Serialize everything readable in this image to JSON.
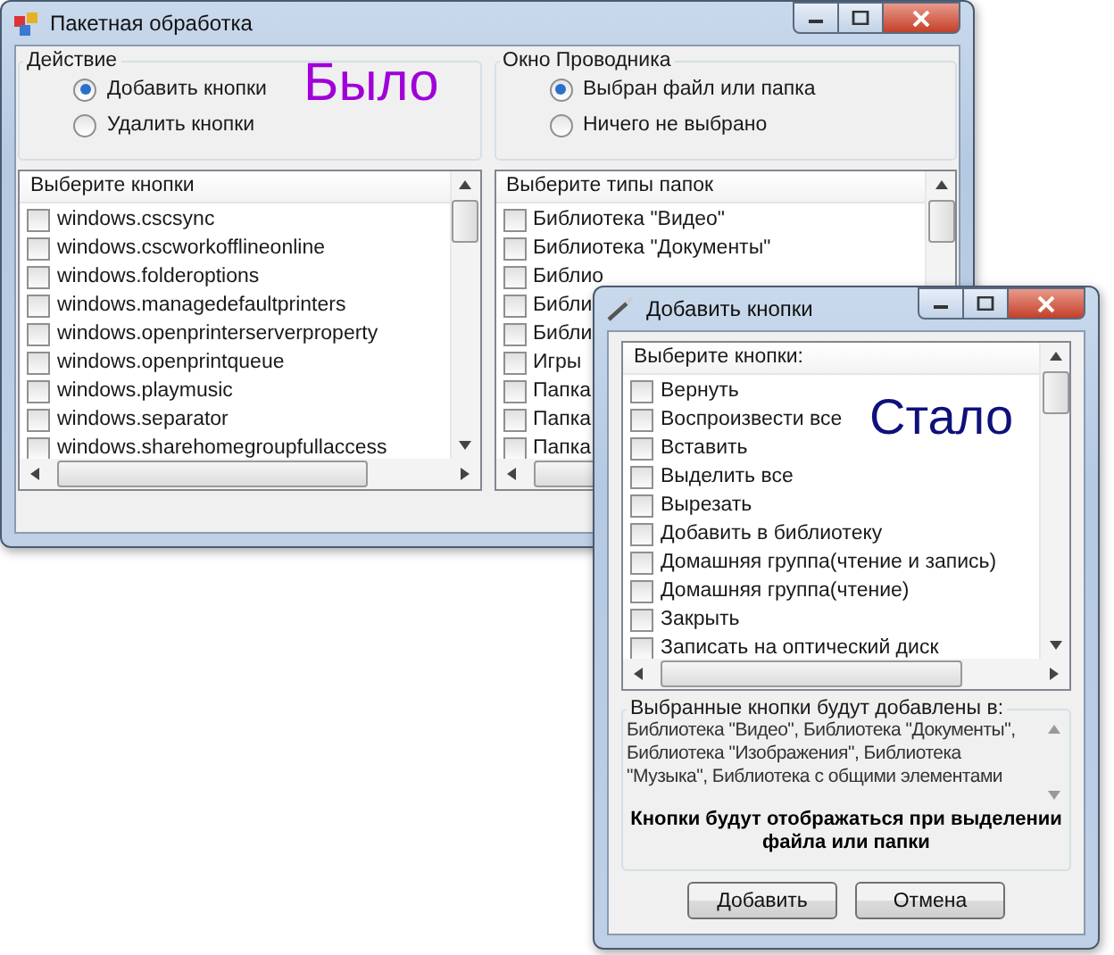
{
  "main_window": {
    "title": "Пакетная обработка",
    "action_group": {
      "title": "Действие",
      "options": [
        {
          "label": "Добавить кнопки",
          "selected": true
        },
        {
          "label": "Удалить кнопки",
          "selected": false
        }
      ]
    },
    "explorer_group": {
      "title": "Окно Проводника",
      "options": [
        {
          "label": "Выбран файл или папка",
          "selected": true
        },
        {
          "label": "Ничего не выбрано",
          "selected": false
        }
      ]
    },
    "buttons_list": {
      "header": "Выберите кнопки",
      "items": [
        {
          "label": "windows.cscsync",
          "checked": false
        },
        {
          "label": "windows.cscworkofflineonline",
          "checked": false
        },
        {
          "label": "windows.folderoptions",
          "checked": false
        },
        {
          "label": "windows.managedefaultprinters",
          "checked": false
        },
        {
          "label": "windows.openprinterserverproperty",
          "checked": false
        },
        {
          "label": "windows.openprintqueue",
          "checked": false
        },
        {
          "label": "windows.playmusic",
          "checked": false
        },
        {
          "label": "windows.separator",
          "checked": false
        },
        {
          "label": "windows.sharehomegroupfullaccess",
          "checked": false
        }
      ]
    },
    "folder_types_list": {
      "header": "Выберите типы папок",
      "items": [
        {
          "label": "Библиотека \"Видео\"",
          "checked": false
        },
        {
          "label": "Библиотека \"Документы\"",
          "checked": false
        },
        {
          "label": "Библио",
          "checked": false
        },
        {
          "label": "Библи",
          "checked": false
        },
        {
          "label": "Библи",
          "checked": false
        },
        {
          "label": "Игры",
          "checked": false
        },
        {
          "label": "Папка",
          "checked": false
        },
        {
          "label": "Папка",
          "checked": false
        },
        {
          "label": "Папка",
          "checked": false
        }
      ]
    }
  },
  "before_label": "Было",
  "after_label": "Стало",
  "add_dialog": {
    "title": "Добавить кнопки",
    "buttons_list": {
      "header": "Выберите кнопки:",
      "items": [
        {
          "label": "Вернуть",
          "checked": false
        },
        {
          "label": "Воспроизвести все",
          "checked": false
        },
        {
          "label": "Вставить",
          "checked": false
        },
        {
          "label": "Выделить все",
          "checked": false
        },
        {
          "label": "Вырезать",
          "checked": false
        },
        {
          "label": "Добавить в библиотеку",
          "checked": false
        },
        {
          "label": "Домашняя группа(чтение и запись)",
          "checked": false
        },
        {
          "label": "Домашняя группа(чтение)",
          "checked": false
        },
        {
          "label": "Закрыть",
          "checked": false
        },
        {
          "label": "Записать на оптический диск",
          "checked": false
        }
      ]
    },
    "target_group": {
      "title": "Выбранные кнопки будут добавлены в:",
      "text": "Библиотека \"Видео\", Библиотека \"Документы\", Библиотека \"Изображения\", Библиотека \"Музыка\", Библиотека с общими элементами",
      "note": "Кнопки будут отображаться при выделении файла или папки"
    },
    "actions": [
      {
        "label": "Добавить"
      },
      {
        "label": "Отмена"
      }
    ]
  }
}
